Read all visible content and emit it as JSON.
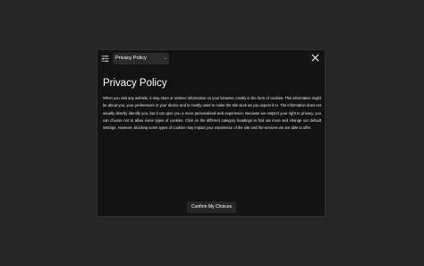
{
  "header": {
    "dropdown_selected": "Privacy Policy",
    "settings_icon": "sliders-icon",
    "close_icon": "close-icon",
    "dropdown_icon": "chevron-down-icon"
  },
  "content": {
    "title": "Privacy Policy",
    "body": "When you visit any website, it may store or retrieve information on your browser, mostly in the form of cookies. This information might be about you, your preferences or your device and is mostly used to make the site work as you expect it to. The information does not usually directly identify you, but it can give you a more personalized web experience. Because we respect your right to privacy, you can choose not to allow some types of cookies. Click on the different category headings to find out more and change our default settings. However, blocking some types of cookies may impact your experience of the site and the services we are able to offer."
  },
  "footer": {
    "confirm_label": "Confirm My Choices"
  },
  "colors": {
    "backdrop": "#262626",
    "modal_bg": "#121212",
    "button_bg": "#262626",
    "text": "#ffffff"
  }
}
